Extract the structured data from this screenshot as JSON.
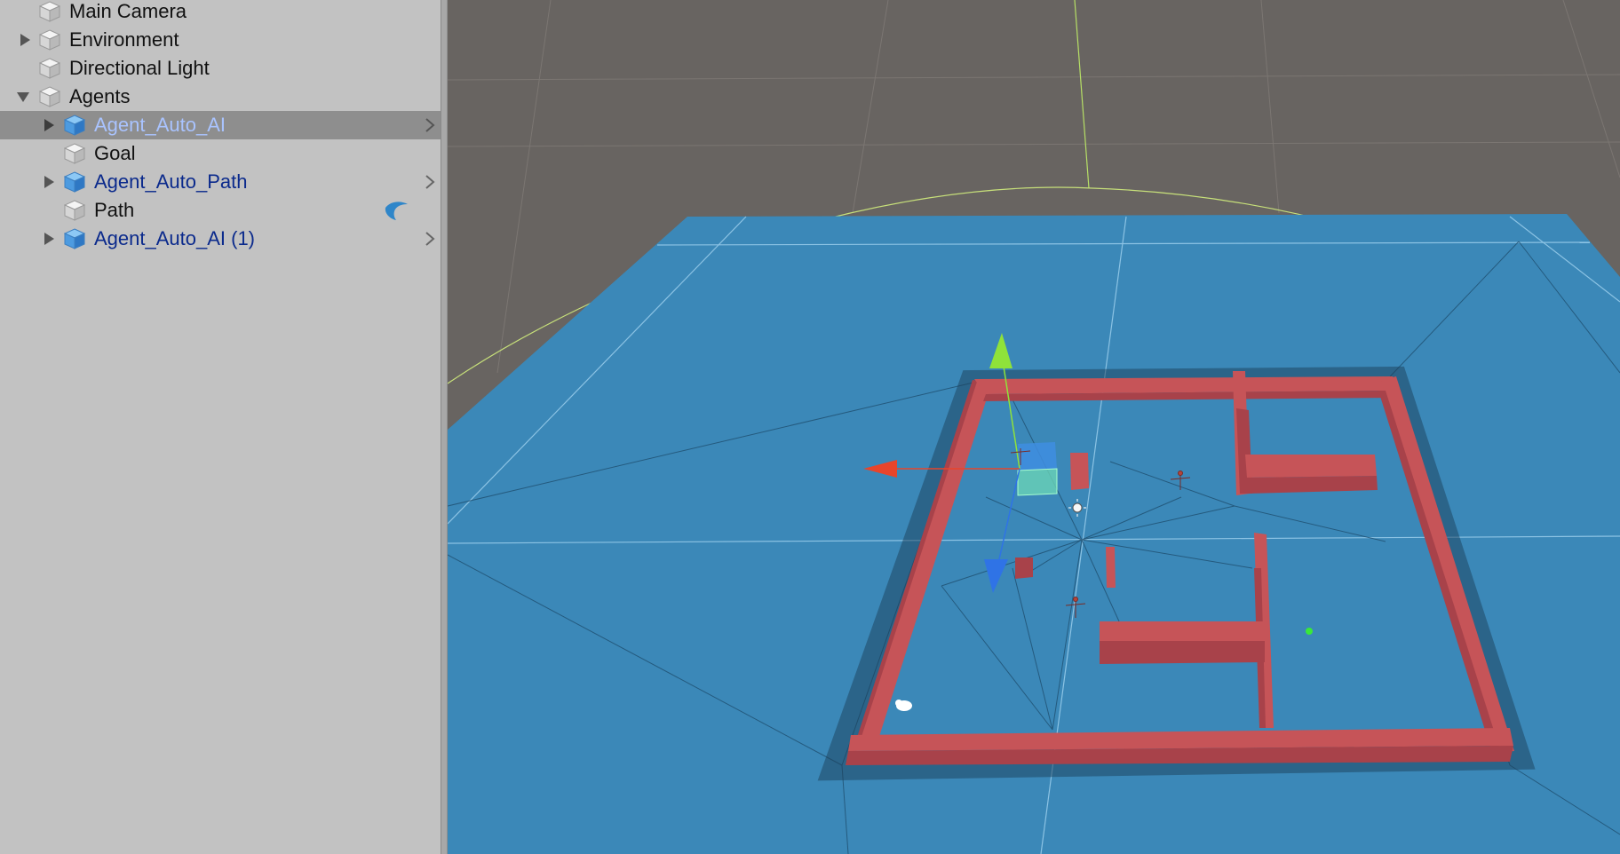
{
  "hierarchy": {
    "items": [
      {
        "label": "Main Camera",
        "icon": "gameobject-icon",
        "expandable": false,
        "expanded": false,
        "prefab": false
      },
      {
        "label": "Environment",
        "icon": "gameobject-icon",
        "expandable": true,
        "expanded": false,
        "prefab": false
      },
      {
        "label": "Directional Light",
        "icon": "gameobject-icon",
        "expandable": false,
        "expanded": false,
        "prefab": false
      },
      {
        "label": "Agents",
        "icon": "gameobject-icon",
        "expandable": true,
        "expanded": true,
        "prefab": false
      },
      {
        "label": "Agent_Auto_AI",
        "icon": "prefab-icon",
        "expandable": true,
        "expanded": false,
        "prefab": true,
        "selected": true
      },
      {
        "label": "Goal",
        "icon": "gameobject-icon",
        "expandable": false,
        "expanded": false,
        "prefab": false
      },
      {
        "label": "Agent_Auto_Path",
        "icon": "prefab-icon",
        "expandable": true,
        "expanded": false,
        "prefab": true
      },
      {
        "label": "Path",
        "icon": "gameobject-icon",
        "expandable": false,
        "expanded": false,
        "prefab": false,
        "badge": "path-component-icon"
      },
      {
        "label": "Agent_Auto_AI (1)",
        "icon": "prefab-icon",
        "expandable": true,
        "expanded": false,
        "prefab": true
      }
    ]
  },
  "colors": {
    "panel_bg": "#c2c2c2",
    "selection": "#8e8e8e",
    "prefab_text": "#0b2a8c",
    "selected_text": "#a9c3ff",
    "scene_bg": "#686461",
    "ground": "#3b88b8",
    "walls": "#c65458",
    "gizmo_x": "#e8452b",
    "gizmo_y": "#8fe23a",
    "gizmo_z": "#2f73e6"
  },
  "scene": {
    "gizmos": [
      "move-x-handle",
      "move-y-handle",
      "move-z-handle",
      "directional-light-icon",
      "audio-listener-icon"
    ]
  }
}
